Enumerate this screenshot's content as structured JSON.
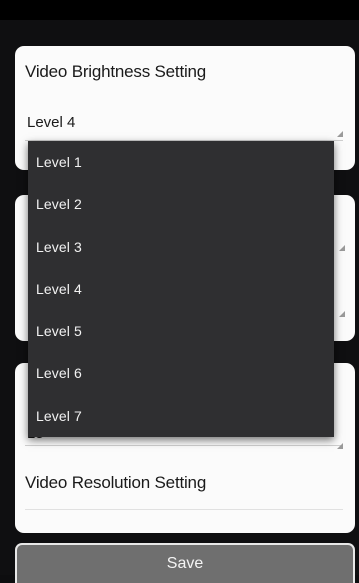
{
  "brightness": {
    "label": "Video Brightness Setting",
    "selected": "Level 4"
  },
  "frame_rate": {
    "value": "15"
  },
  "resolution": {
    "label": "Video Resolution Setting"
  },
  "dropdown": {
    "options": [
      "Level 1",
      "Level 2",
      "Level 3",
      "Level 4",
      "Level 5",
      "Level 6",
      "Level 7"
    ]
  },
  "actions": {
    "save_label": "Save"
  },
  "colors": {
    "background": "#0f0f11",
    "card": "#fbfbfb",
    "dropdown": "#2f2f31",
    "button": "#6f6f6f"
  }
}
